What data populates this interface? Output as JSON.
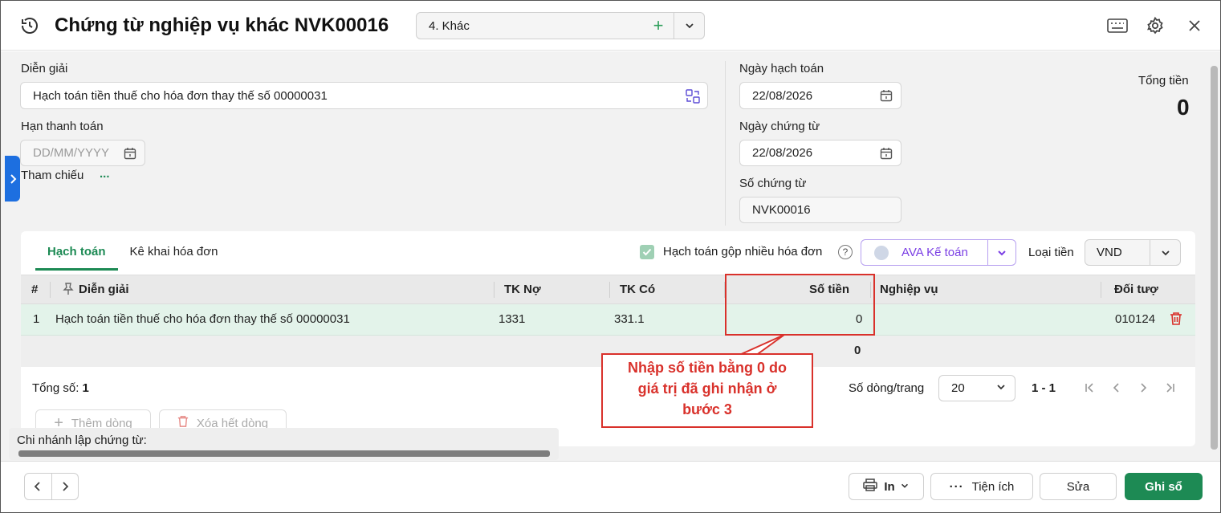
{
  "header": {
    "title": "Chứng từ nghiệp vụ khác NVK00016",
    "type_select": "4. Khác"
  },
  "form": {
    "dien_giai_label": "Diễn giải",
    "dien_giai_value": "Hạch toán tiền thuế cho hóa đơn thay thế số 00000031",
    "han_thanh_toan_label": "Hạn thanh toán",
    "han_thanh_toan_placeholder": "DD/MM/YYYY",
    "tham_chieu_label": "Tham chiếu",
    "tham_chieu_more": "...",
    "ngay_hach_toan_label": "Ngày hạch toán",
    "ngay_hach_toan_value": "22/08/2026",
    "ngay_chung_tu_label": "Ngày chứng từ",
    "ngay_chung_tu_value": "22/08/2026",
    "so_chung_tu_label": "Số chứng từ",
    "so_chung_tu_value": "NVK00016",
    "tong_tien_label": "Tổng tiền",
    "tong_tien_value": "0"
  },
  "tabs": [
    {
      "label": "Hạch toán",
      "active": true
    },
    {
      "label": "Kê khai hóa đơn",
      "active": false
    }
  ],
  "toolbar": {
    "gop_label": "Hạch toán gộp nhiều hóa đơn",
    "ava_label": "AVA Kế toán",
    "loai_tien_label": "Loại tiền",
    "currency": "VND"
  },
  "table": {
    "columns": [
      "#",
      "Diễn giải",
      "TK Nợ",
      "TK Có",
      "Số tiền",
      "Nghiệp vụ",
      "Đối tượ"
    ],
    "rows": [
      {
        "no": "1",
        "dien_giai": "Hạch toán tiền thuế cho hóa đơn thay thế số 00000031",
        "tk_no": "1331",
        "tk_co": "331.1",
        "so_tien": "0",
        "nghiep_vu": "",
        "doi_tuong": "010124"
      }
    ],
    "sum_so_tien": "0"
  },
  "pagination": {
    "tong_so_label": "Tổng số:",
    "tong_so_value": "1",
    "rows_per_page_label": "Số dòng/trang",
    "rows_per_page": "20",
    "range": "1 - 1"
  },
  "row_actions": {
    "add_label": "Thêm dòng",
    "clear_label": "Xóa hết dòng"
  },
  "branch_label": "Chi nhánh lập chứng từ:",
  "callout": {
    "line1": "Nhập số tiền bằng 0 do",
    "line2": "giá trị đã ghi nhận ở",
    "line3": "bước 3"
  },
  "footer": {
    "print_label": "In",
    "utility_label": "Tiện ích",
    "edit_label": "Sửa",
    "post_label": "Ghi sổ"
  },
  "colors": {
    "accent": "#1d8a54",
    "callout": "#d9312b",
    "ava": "#7b3fe4"
  }
}
